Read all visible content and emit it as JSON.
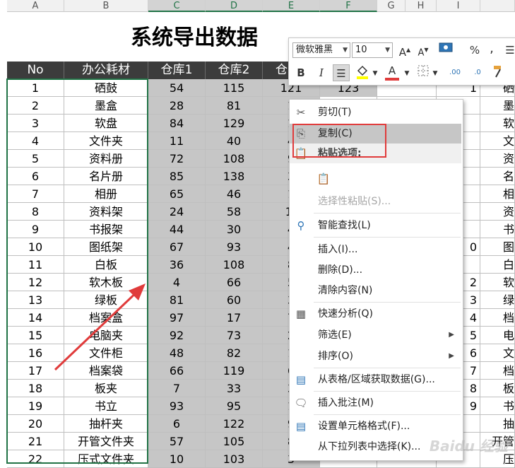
{
  "columns": [
    "A",
    "B",
    "C",
    "D",
    "E",
    "F",
    "G",
    "H",
    "I"
  ],
  "title": "系统导出数据",
  "headers": [
    "No",
    "办公耗材",
    "仓库1",
    "仓库2",
    "仓"
  ],
  "rows": [
    {
      "no": "1",
      "name": "硒鼓",
      "c": "54",
      "d": "115",
      "e": "121",
      "f": "123"
    },
    {
      "no": "2",
      "name": "墨盒",
      "c": "28",
      "d": "81",
      "e": "1"
    },
    {
      "no": "3",
      "name": "软盘",
      "c": "84",
      "d": "129",
      "e": "1"
    },
    {
      "no": "4",
      "name": "文件夹",
      "c": "11",
      "d": "40",
      "e": "4"
    },
    {
      "no": "5",
      "name": "资料册",
      "c": "72",
      "d": "108",
      "e": "9"
    },
    {
      "no": "6",
      "name": "名片册",
      "c": "85",
      "d": "138",
      "e": "3"
    },
    {
      "no": "7",
      "name": "相册",
      "c": "65",
      "d": "46",
      "e": "1"
    },
    {
      "no": "8",
      "name": "资料架",
      "c": "24",
      "d": "58",
      "e": "1("
    },
    {
      "no": "9",
      "name": "书报架",
      "c": "44",
      "d": "30",
      "e": "4"
    },
    {
      "no": "10",
      "name": "图纸架",
      "c": "67",
      "d": "93",
      "e": "4"
    },
    {
      "no": "11",
      "name": "白板",
      "c": "36",
      "d": "108",
      "e": "8"
    },
    {
      "no": "12",
      "name": "软木板",
      "c": "4",
      "d": "66",
      "e": "5"
    },
    {
      "no": "13",
      "name": "绿板",
      "c": "81",
      "d": "60",
      "e": "3"
    },
    {
      "no": "14",
      "name": "档案盒",
      "c": "97",
      "d": "17",
      "e": "7"
    },
    {
      "no": "15",
      "name": "电脑夹",
      "c": "92",
      "d": "73",
      "e": "2"
    },
    {
      "no": "16",
      "name": "文件柜",
      "c": "48",
      "d": "82",
      "e": "1"
    },
    {
      "no": "17",
      "name": "档案袋",
      "c": "66",
      "d": "119",
      "e": "6"
    },
    {
      "no": "18",
      "name": "板夹",
      "c": "7",
      "d": "33",
      "e": "3"
    },
    {
      "no": "19",
      "name": "书立",
      "c": "93",
      "d": "95",
      "e": "1"
    },
    {
      "no": "20",
      "name": "抽杆夹",
      "c": "6",
      "d": "122",
      "e": "9"
    },
    {
      "no": "21",
      "name": "开管文件夹",
      "c": "57",
      "d": "105",
      "e": "8"
    },
    {
      "no": "22",
      "name": "压式文件夹",
      "c": "10",
      "d": "103",
      "e": "3"
    }
  ],
  "right_col_i": [
    "1",
    "",
    "",
    "",
    "",
    "",
    "",
    "",
    "",
    "0",
    "",
    "2",
    "3",
    "4",
    "5",
    "6",
    "7",
    "8",
    "9",
    "",
    "",
    ""
  ],
  "right_col_j": [
    "硒",
    "墨",
    "软",
    "文",
    "资",
    "名",
    "相",
    "资",
    "书",
    "图",
    "白",
    "软",
    "绿",
    "档",
    "电",
    "文",
    "档",
    "板",
    "书",
    "抽",
    "开管",
    "压"
  ],
  "minibar": {
    "font": "微软雅黑",
    "size": "10",
    "grow": "A",
    "shrink": "A",
    "percent": "%",
    "comma": ",",
    "bold": "B",
    "italic": "I",
    "fontcolor": "A",
    "dec_more": ".00",
    "dec_less": ".0"
  },
  "menu": {
    "cut": "剪切(T)",
    "copy": "复制(C)",
    "paste_options": "粘贴选项:",
    "paste_special": "选择性粘贴(S)...",
    "smart_lookup": "智能查找(L)",
    "insert": "插入(I)...",
    "delete": "删除(D)...",
    "clear": "清除内容(N)",
    "quick_analysis": "快速分析(Q)",
    "filter": "筛选(E)",
    "sort": "排序(O)",
    "from_table": "从表格/区域获取数据(G)...",
    "insert_comment": "插入批注(M)",
    "format_cells": "设置单元格格式(F)...",
    "pick_list": "从下拉列表中选择(K)..."
  },
  "watermark": "Baidu 经验"
}
